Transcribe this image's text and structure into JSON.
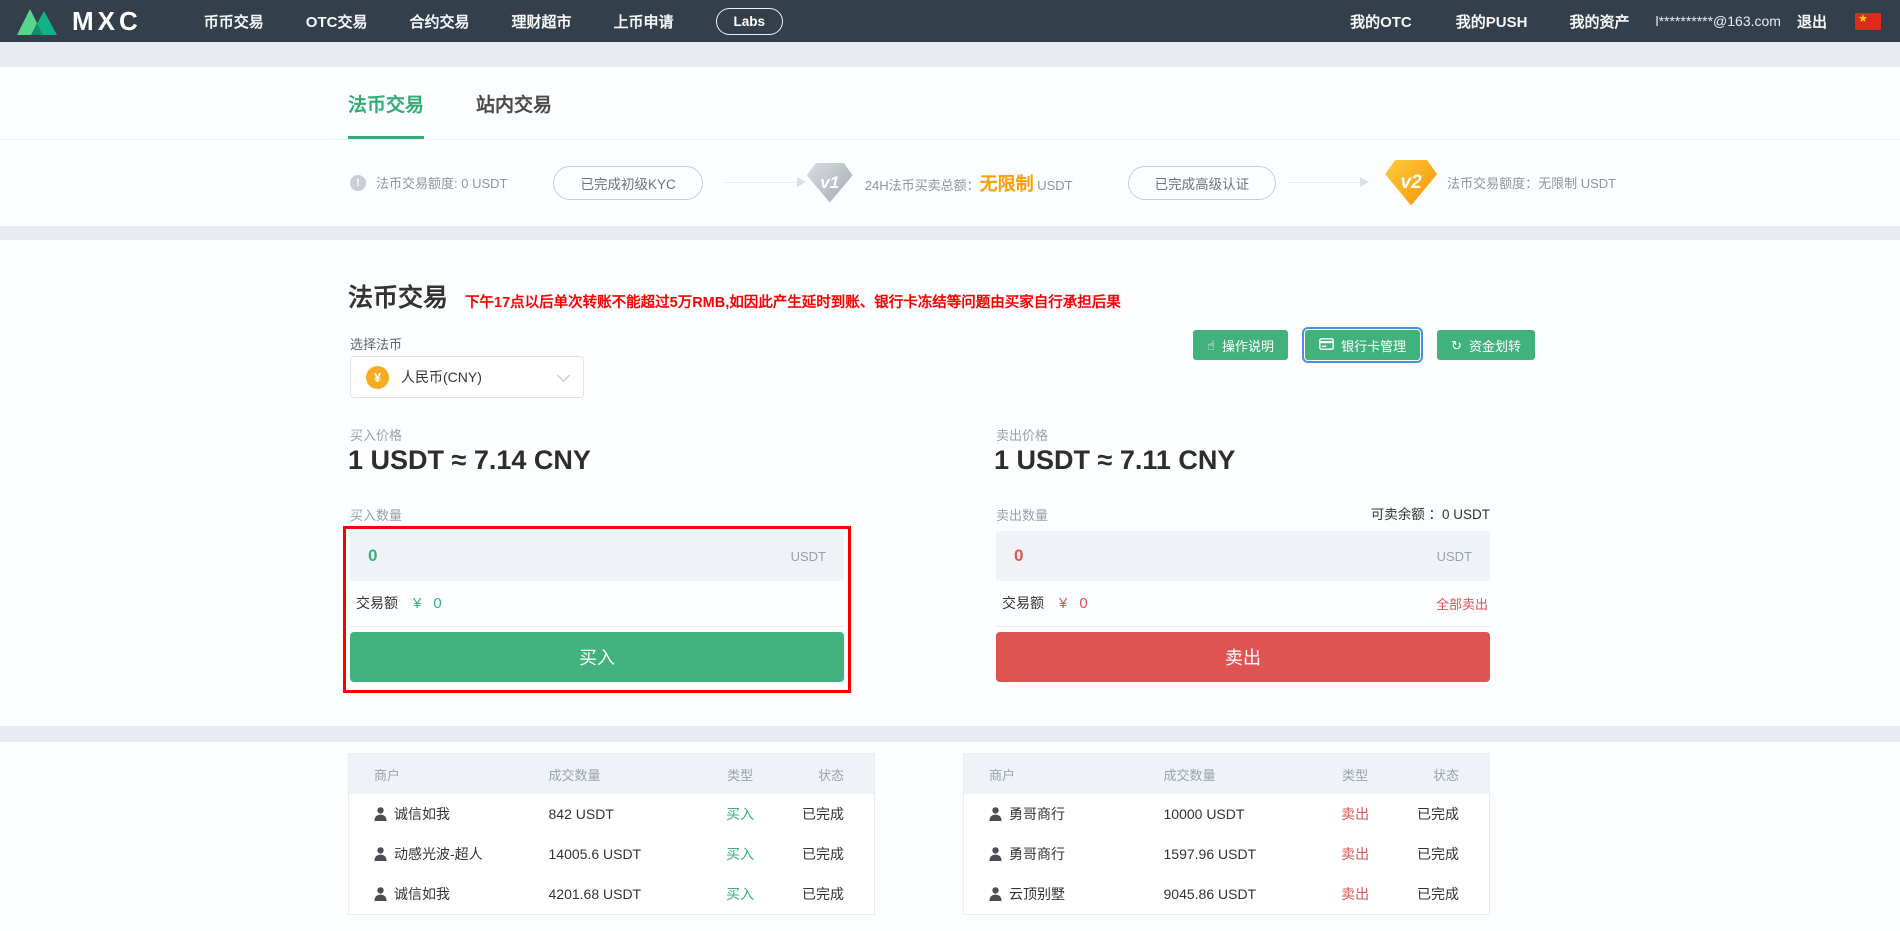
{
  "nav": {
    "brand": "MXC",
    "items": [
      "币币交易",
      "OTC交易",
      "合约交易",
      "理财超市",
      "上币申请"
    ],
    "labs": "Labs",
    "user_items": [
      "我的OTC",
      "我的PUSH",
      "我的资产"
    ],
    "email": "l**********@163.com",
    "logout": "退出",
    "flag_star": "★"
  },
  "tabs": {
    "fiat": "法币交易",
    "internal": "站内交易"
  },
  "kyc": {
    "warn_icon": "!",
    "quota_label": "法币交易额度: 0 USDT",
    "kyc1_pill": "已完成初级KYC",
    "v1_badge": "v1",
    "total_prefix": "24H法币买卖总额：",
    "total_highlight": "无限制",
    "total_suffix": " USDT",
    "kyc2_pill": "已完成高级认证",
    "v2_badge": "v2",
    "v2_quota": "法币交易额度：无限制 USDT"
  },
  "main": {
    "title": "法币交易",
    "warning": "下午17点以后单次转账不能超过5万RMB,如因此产生延时到账、银行卡冻结等问题由买家自行承担后果",
    "select_label": "选择法币",
    "currency_symbol": "¥",
    "currency": "人民币(CNY)",
    "action_buttons": [
      "操作说明",
      "银行卡管理",
      "资金划转"
    ],
    "icons": {
      "hand": "☝",
      "transfer": "↻"
    },
    "buy": {
      "price_label": "买入价格",
      "price": "1 USDT ≈ 7.14 CNY",
      "qty_label": "买入数量",
      "input_value": "0",
      "unit": "USDT",
      "amount_label": "交易额",
      "amount_symbol": "¥",
      "amount_value": "0",
      "button": "买入"
    },
    "sell": {
      "price_label": "卖出价格",
      "price": "1 USDT ≈ 7.11 CNY",
      "qty_label": "卖出数量",
      "balance": "可卖余额 ：0 USDT",
      "input_value": "0",
      "unit": "USDT",
      "amount_label": "交易额",
      "amount_symbol": "¥",
      "amount_value": "0",
      "sell_all": "全部卖出",
      "button": "卖出"
    }
  },
  "tables": {
    "headers": [
      "商户",
      "成交数量",
      "类型",
      "状态"
    ],
    "left": {
      "rows": [
        {
          "merchant": "诚信如我",
          "amount": "842 USDT",
          "type": "买入",
          "status": "已完成"
        },
        {
          "merchant": "动感光波-超人",
          "amount": "14005.6 USDT",
          "type": "买入",
          "status": "已完成"
        },
        {
          "merchant": "诚信如我",
          "amount": "4201.68 USDT",
          "type": "买入",
          "status": "已完成"
        }
      ]
    },
    "right": {
      "rows": [
        {
          "merchant": "勇哥商行",
          "amount": "10000 USDT",
          "type": "卖出",
          "status": "已完成"
        },
        {
          "merchant": "勇哥商行",
          "amount": "1597.96 USDT",
          "type": "卖出",
          "status": "已完成"
        },
        {
          "merchant": "云顶别墅",
          "amount": "9045.86 USDT",
          "type": "卖出",
          "status": "已完成"
        }
      ]
    }
  },
  "colors": {
    "nav_bg": "#343f4c",
    "green": "#41b17e",
    "red": "#df5451",
    "warning_red": "#fc0000",
    "orange_highlight": "#ff9d00"
  }
}
